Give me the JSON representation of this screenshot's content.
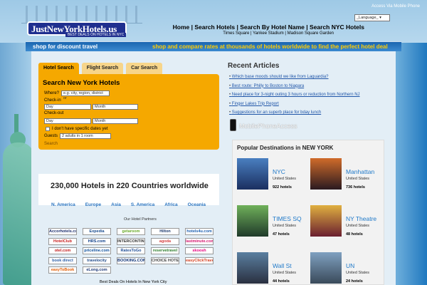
{
  "header": {
    "logo_text": "JustNewYorkHotels.us",
    "logo_tagline": "BEST DEALS ON HOTELS IN NYC",
    "mobile_link": "Access Via Mobile Phone",
    "language_select": "_Language_",
    "nav": [
      "Home",
      "Search Hotels",
      "Search By Hotel Name",
      "Search NYC Hotels"
    ],
    "subnav": [
      "Times Square",
      "Yankee Stadium",
      "Madison Square Garden"
    ]
  },
  "bar": {
    "left": "shop for discount travel",
    "right": "shop and compare rates at thousands of hotels worldwide to find the perfect hotel deal"
  },
  "tabs": [
    "Hotel Search",
    "Flight Search",
    "Car Search"
  ],
  "search": {
    "title": "Search New York Hotels",
    "where_label": "Where?",
    "where_placeholder": "e.g. city, region, district or",
    "checkin_label": "Check-in",
    "checkout_label": "Check-out",
    "day": "Day",
    "month": "Month",
    "no_dates": "I don't have specific dates yet",
    "guests_label": "Guests",
    "guests_value": "2 adults in 1 room",
    "search_link": "Search"
  },
  "stats": {
    "text": "230,000 Hotels in 220 Countries worldwide",
    "regions": [
      "N. America",
      "Europe",
      "Asia",
      "S. America",
      "Africa",
      "Oceania"
    ]
  },
  "partners": {
    "title": "Our Hotel Partners",
    "logos": [
      {
        "name": "Accorhotels.com",
        "color": "#1c2e6e"
      },
      {
        "name": "Expedia",
        "color": "#1a4d8f"
      },
      {
        "name": "getaroom",
        "color": "#6aaa2a"
      },
      {
        "name": "Hilton",
        "color": "#1f3b6f"
      },
      {
        "name": "hotels4u.com",
        "color": "#1c5fb0"
      },
      {
        "name": "HotelClub",
        "color": "#c81f1f"
      },
      {
        "name": "HRS.com",
        "color": "#0e3f8a"
      },
      {
        "name": "INTERCONTINENTAL",
        "color": "#333333"
      },
      {
        "name": "agoda",
        "color": "#d43f3f"
      },
      {
        "name": "lastminute.com",
        "color": "#d4166f"
      },
      {
        "name": "otel.com",
        "color": "#c21a1a"
      },
      {
        "name": "priceline.com",
        "color": "#0b4e9b"
      },
      {
        "name": "RatesToGo",
        "color": "#1f4e96"
      },
      {
        "name": "reservetravel",
        "color": "#2a7b2a"
      },
      {
        "name": "skoosh",
        "color": "#e6007e"
      },
      {
        "name": "book direct",
        "color": "#2a5ea8"
      },
      {
        "name": "travelocity",
        "color": "#1f4a8a"
      },
      {
        "name": "BOOKING.COM",
        "color": "#0d3276"
      },
      {
        "name": "CHOICE HOTELS",
        "color": "#444444"
      },
      {
        "name": "easyClickTravel",
        "color": "#d43f1f"
      },
      {
        "name": "easyToBook",
        "color": "#e05a00"
      },
      {
        "name": "eLong.com",
        "color": "#1f3b7a"
      }
    ]
  },
  "bottom_note": "Best Deals On Hotels In New York City",
  "recent": {
    "title": "Recent Articles",
    "articles": [
      "Which base moods should we like from Laguardia?",
      "Best route: Philly to Boston to Niagara",
      "Need place for 3-night outing 3 hours or reduction from Northern NJ",
      "Finger Lakes Trip Report",
      "Suggestions for an superb place for bday lunch"
    ]
  },
  "mobile_access": "MobilePhoneAccess",
  "popular": {
    "title": "Popular Destinations in NEW YORK",
    "destinations": [
      {
        "name": "NYC",
        "country": "United States",
        "hotels": "922 hotels"
      },
      {
        "name": "Manhattan",
        "country": "United States",
        "hotels": "736 hotels"
      },
      {
        "name": "TIMES SQ",
        "country": "United States",
        "hotels": "47 hotels"
      },
      {
        "name": "NY Theatre",
        "country": "United States",
        "hotels": "48 hotels"
      },
      {
        "name": "Wall St",
        "country": "United States",
        "hotels": "44 hotels"
      },
      {
        "name": "UN",
        "country": "United States",
        "hotels": "24 hotels"
      }
    ]
  },
  "colors": {
    "accent_orange": "#f5a800",
    "bar_blue": "#1a66b0",
    "bar_highlight": "#ffcc00",
    "link_blue": "#1f79c9"
  }
}
